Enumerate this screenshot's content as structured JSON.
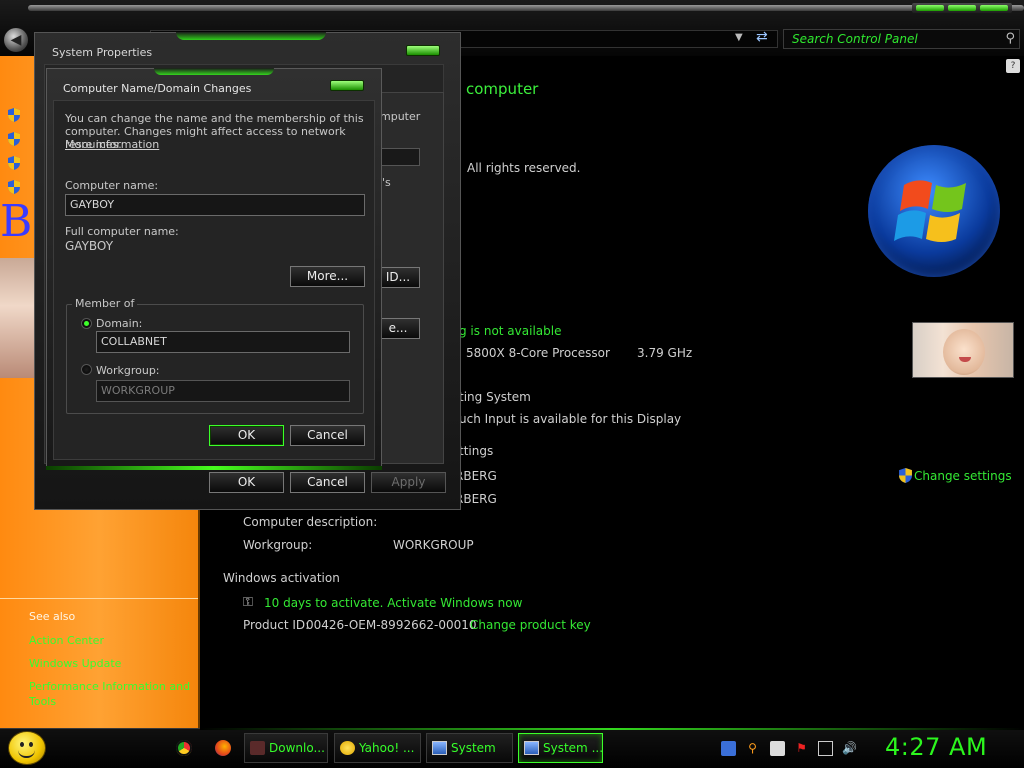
{
  "search": {
    "placeholder": "Search Control Panel"
  },
  "left_pane": {
    "big_letter": "B",
    "see_also": "See also",
    "links": [
      "Action Center",
      "Windows Update",
      "Performance Information and Tools"
    ]
  },
  "main": {
    "heading_fragment": "computer",
    "copyright_fragment": "All rights reserved.",
    "rating_fragment": "g is not available",
    "processor_fragment": "5800X 8-Core Processor",
    "processor_speed": "3.79 GHz",
    "system_type_fragment": "ting System",
    "pen_fragment": "uch Input is available for this Display",
    "settings_heading_fragment": "ttings",
    "computer_name_fragment": "RBERG",
    "full_name_fragment": "RBERG",
    "change_settings": "Change settings",
    "computer_description_label": "Computer description:",
    "workgroup_label": "Workgroup:",
    "workgroup_value": "WORKGROUP",
    "activation_heading": "Windows activation",
    "activation_status": "10 days to activate. Activate Windows now",
    "product_id_label": "Product ID:",
    "product_id_value": "00426-OEM-8992662-00010",
    "change_product_key": "Change product key"
  },
  "system_properties": {
    "title": "System Properties",
    "frag_computer": "mputer",
    "frag_s": "'s",
    "frag_id_button": "ID...",
    "frag_e_button": "e...",
    "ok": "OK",
    "cancel": "Cancel",
    "apply": "Apply"
  },
  "dialog": {
    "title": "Computer Name/Domain Changes",
    "description": "You can change the name and the membership of this computer. Changes might affect access to network resources.",
    "more_info_link": "More information",
    "computer_name_label": "Computer name:",
    "computer_name_value": "GAYBOY",
    "full_name_label": "Full computer name:",
    "full_name_value": "GAYBOY",
    "more_button": "More...",
    "member_of": "Member of",
    "domain_label": "Domain:",
    "domain_value": "COLLABNET",
    "workgroup_label": "Workgroup:",
    "workgroup_value": "WORKGROUP",
    "ok": "OK",
    "cancel": "Cancel"
  },
  "taskbar": {
    "buttons": [
      "Downlo...",
      "Yahoo! ...",
      "System",
      "System ..."
    ],
    "clock": "4:27 AM"
  },
  "colors": {
    "accent_green": "#34e834",
    "orange_pane": "#ff9a22"
  }
}
